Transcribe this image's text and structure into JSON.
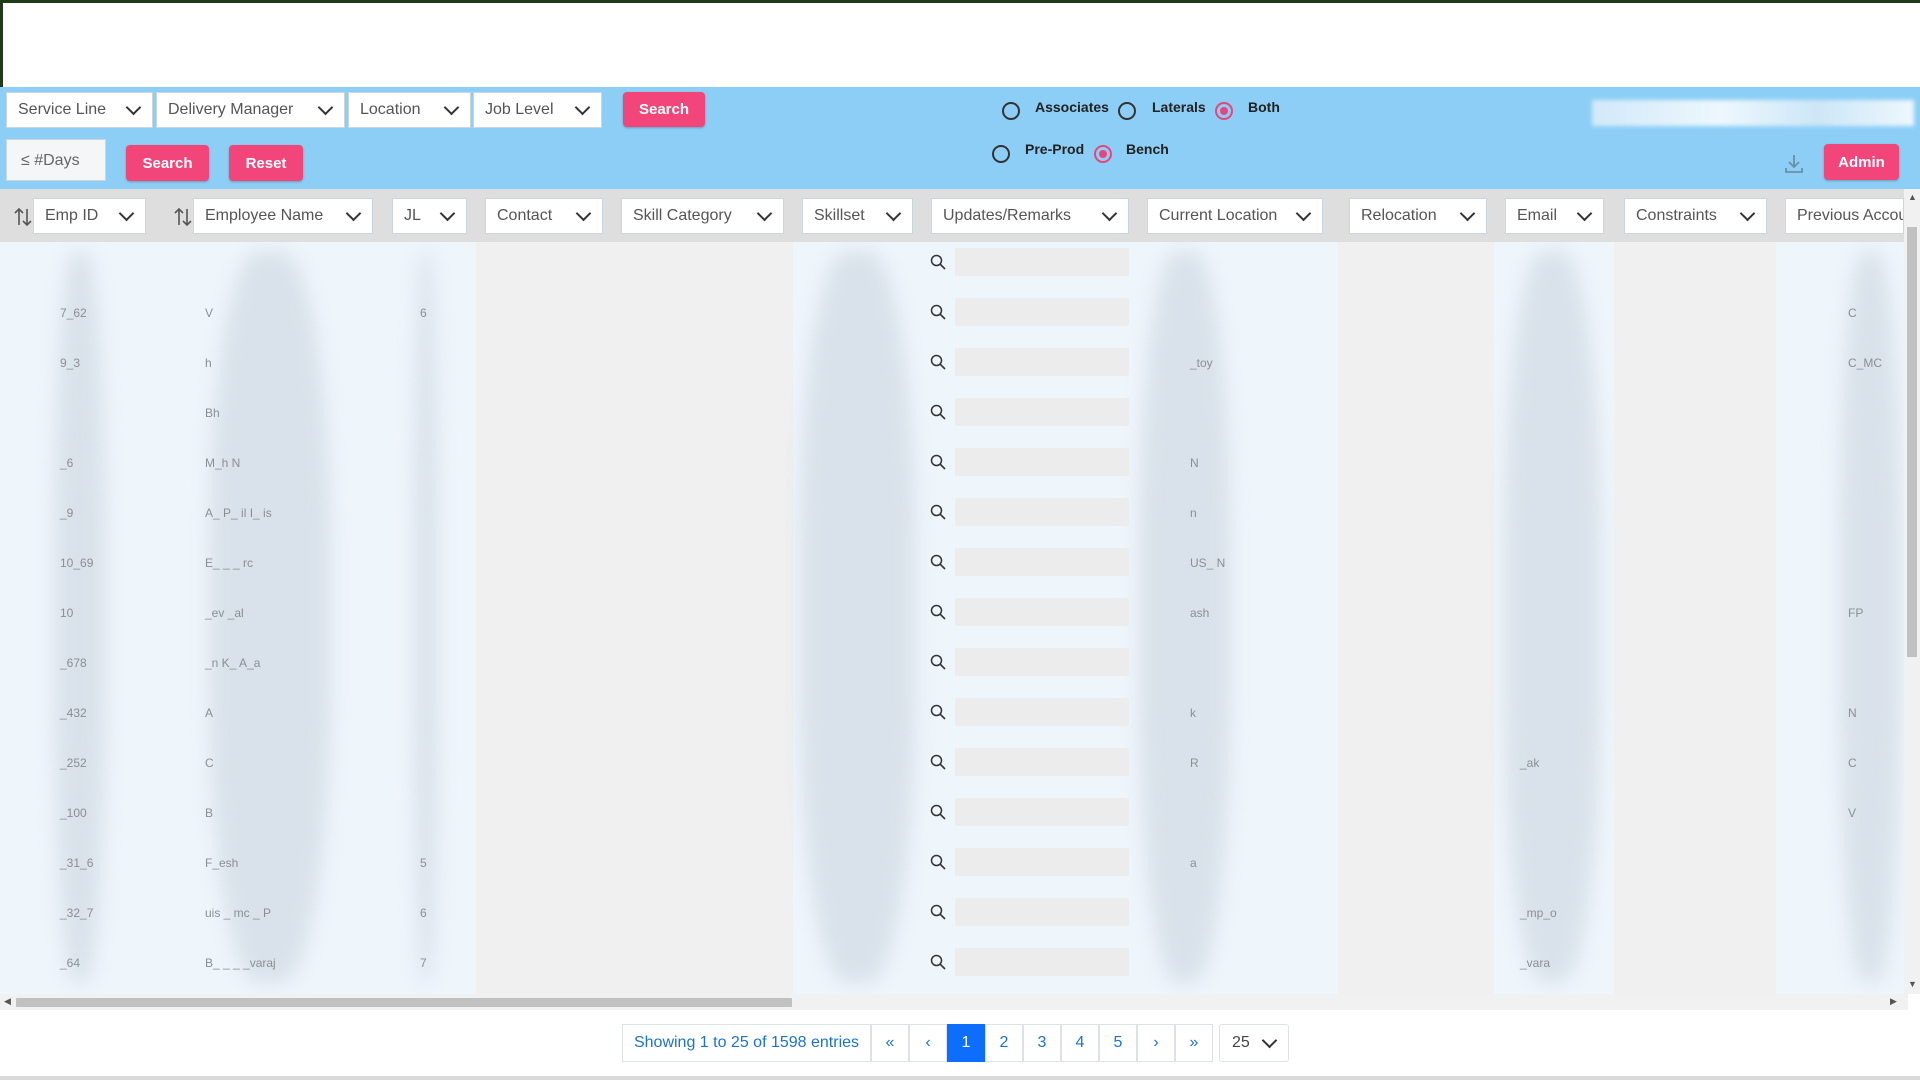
{
  "filters": {
    "service_line": "Service Line",
    "delivery_manager": "Delivery Manager",
    "location": "Location",
    "job_level": "Job Level",
    "search_label": "Search",
    "days_placeholder": "≤ #Days",
    "search2_label": "Search",
    "reset_label": "Reset"
  },
  "radios": {
    "group1": [
      {
        "label": "Associates",
        "checked": false
      },
      {
        "label": "Laterals",
        "checked": false
      },
      {
        "label": "Both",
        "checked": true
      }
    ],
    "group2": [
      {
        "label": "Pre-Prod",
        "checked": false
      },
      {
        "label": "Bench",
        "checked": true
      }
    ]
  },
  "header_right": {
    "admin_label": "Admin",
    "download_icon": "download-icon"
  },
  "columns": [
    "Emp ID",
    "Employee Name",
    "JL",
    "Contact",
    "Skill Category",
    "Skillset",
    "Updates/Remarks",
    "Current Location",
    "Relocation",
    "Email",
    "Constraints",
    "Previous Accou"
  ],
  "table": {
    "emp_id": [
      "",
      "7_62",
      "9_3",
      "",
      "_6",
      "_9",
      "10_69",
      "10",
      "_678",
      "_432",
      "_252",
      "_100",
      "_31_6",
      "_32_7",
      "_64"
    ],
    "employee_name": [
      "",
      "V",
      "h",
      "Bh",
      "M_h N",
      "A_ P_ il I_ is",
      "E_ _ _ rc",
      "_ev _al",
      "_n K_ A_a",
      "A",
      "C",
      "B",
      "F_esh",
      "uis _ mc _ P",
      "B_ _ _ _varaj"
    ],
    "jl": [
      "",
      "6",
      "",
      "",
      "",
      "",
      "",
      "",
      "",
      "",
      "",
      "",
      "5",
      "6",
      "7"
    ],
    "current_location": [
      "",
      "",
      "_toy",
      "",
      "N",
      "n",
      "US_ N",
      "ash",
      "",
      "k",
      "R",
      "",
      "a",
      "",
      ""
    ],
    "email": [
      "",
      "",
      "",
      "",
      "",
      "",
      "",
      "",
      "",
      "",
      "_ak",
      "",
      "",
      "_mp_o",
      "_vara"
    ],
    "previous": [
      "",
      "C",
      "C_MC",
      "",
      "",
      "",
      "",
      "FP",
      "",
      "N",
      "C",
      "V",
      "",
      "",
      ""
    ]
  },
  "pagination": {
    "info": "Showing 1 to 25 of 1598 entries",
    "first": "«",
    "prev": "‹",
    "pages": [
      "1",
      "2",
      "3",
      "4",
      "5"
    ],
    "active_page": "1",
    "next": "›",
    "last": "»",
    "page_size": "25"
  },
  "colors": {
    "filter_bg": "#8ccef5",
    "accent_pink": "#f2467a",
    "active_page": "#0d6efd"
  }
}
